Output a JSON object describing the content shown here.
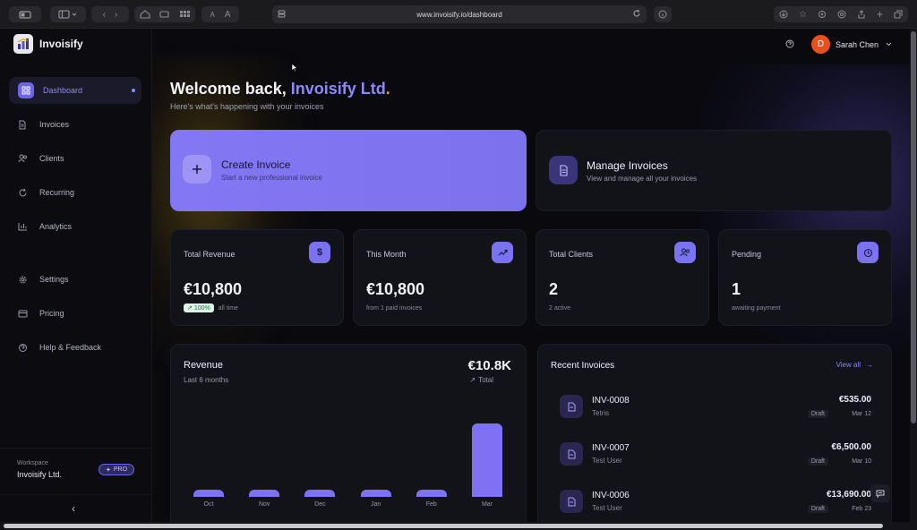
{
  "browser": {
    "url": "www.invoisify.io/dashboard",
    "reader_a": "A",
    "reader_b": "A"
  },
  "app": {
    "brand": "Invoisify",
    "user_name": "Sarah Chen",
    "user_initial": "D",
    "accent": "#7b72f0"
  },
  "sidebar": {
    "items": [
      {
        "label": "Dashboard",
        "icon": "grid-icon"
      },
      {
        "label": "Invoices",
        "icon": "document-icon"
      },
      {
        "label": "Clients",
        "icon": "users-icon"
      },
      {
        "label": "Recurring",
        "icon": "refresh-icon"
      },
      {
        "label": "Analytics",
        "icon": "chart-icon"
      },
      {
        "label": "Settings",
        "icon": "gear-icon"
      },
      {
        "label": "Pricing",
        "icon": "card-icon"
      },
      {
        "label": "Help & Feedback",
        "icon": "help-icon"
      }
    ],
    "workspace_label": "Workspace",
    "workspace_name": "Invoisify Ltd.",
    "plan_badge": "PRO"
  },
  "header": {
    "welcome_prefix": "Welcome back, ",
    "company": "Invoisify Ltd",
    "period": ".",
    "subtitle": "Here's what's happening with your invoices"
  },
  "actions": {
    "create_title": "Create Invoice",
    "create_sub": "Start a new professional invoice",
    "manage_title": "Manage Invoices",
    "manage_sub": "View and manage all your invoices"
  },
  "stats": [
    {
      "label": "Total Revenue",
      "value": "€10,800",
      "badge": "100%",
      "sub": "all time",
      "icon": "dollar-icon"
    },
    {
      "label": "This Month",
      "value": "€10,800",
      "sub": "from 1 paid invoices",
      "icon": "trend-icon"
    },
    {
      "label": "Total Clients",
      "value": "2",
      "sub": "2 active",
      "icon": "users-icon"
    },
    {
      "label": "Pending",
      "value": "1",
      "sub": "awaiting payment",
      "icon": "clock-icon"
    }
  ],
  "revenue": {
    "title": "Revenue",
    "subtitle": "Last 6 months",
    "total": "€10.8K",
    "total_label": "Total"
  },
  "chart_data": {
    "type": "bar",
    "categories": [
      "Oct",
      "Nov",
      "Dec",
      "Jan",
      "Feb",
      "Mar"
    ],
    "values": [
      0,
      0,
      0,
      0,
      0,
      10800
    ],
    "title": "Revenue",
    "xlabel": "",
    "ylabel": ""
  },
  "recent": {
    "title": "Recent Invoices",
    "view_all": "View all",
    "invoices": [
      {
        "number": "INV-0008",
        "client": "Tetris",
        "amount": "€535.00",
        "status": "Draft",
        "date": "Mar 12"
      },
      {
        "number": "INV-0007",
        "client": "Test User",
        "amount": "€6,500.00",
        "status": "Draft",
        "date": "Mar 10"
      },
      {
        "number": "INV-0006",
        "client": "Test User",
        "amount": "€13,690.00",
        "status": "Draft",
        "date": "Feb 23"
      }
    ]
  }
}
